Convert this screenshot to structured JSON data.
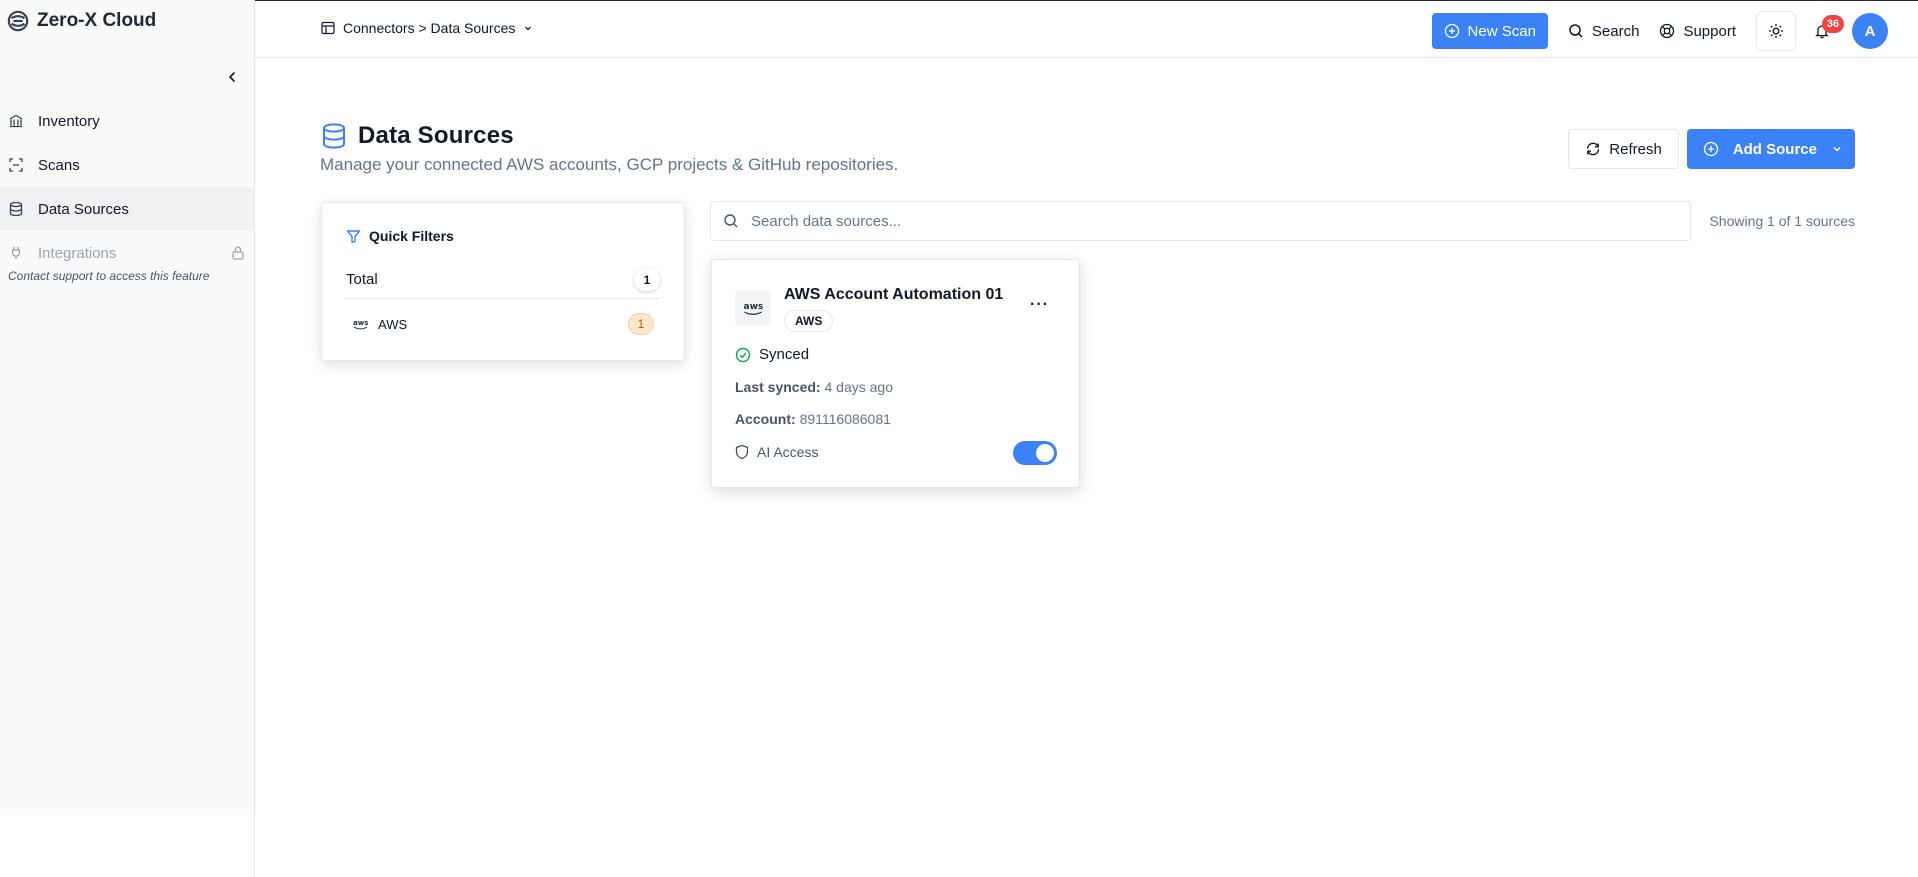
{
  "brand": {
    "name": "Zero-X Cloud"
  },
  "sidebar": {
    "items": [
      {
        "label": "Inventory",
        "icon": "bank-icon"
      },
      {
        "label": "Scans",
        "icon": "scan-icon"
      },
      {
        "label": "Data Sources",
        "icon": "database-icon",
        "active": true
      },
      {
        "label": "Integrations",
        "icon": "plug-icon",
        "disabled": true
      }
    ],
    "note": "Contact support to access this feature"
  },
  "header": {
    "breadcrumb": "Connectors > Data Sources",
    "new_scan_label": "New Scan",
    "search_label": "Search",
    "support_label": "Support",
    "notification_count": "36",
    "avatar_initial": "A"
  },
  "page": {
    "title": "Data Sources",
    "subtitle": "Manage your connected AWS accounts, GCP projects & GitHub repositories.",
    "refresh_label": "Refresh",
    "add_source_label": "Add Source"
  },
  "filters": {
    "title": "Quick Filters",
    "total_label": "Total",
    "total_count": "1",
    "items": [
      {
        "label": "AWS",
        "count": "1"
      }
    ]
  },
  "search": {
    "placeholder": "Search data sources...",
    "showing": "Showing 1 of 1 sources"
  },
  "sources": [
    {
      "name": "AWS Account Automation 01",
      "tag": "AWS",
      "logo_text": "aws",
      "status": "Synced",
      "last_synced_label": "Last synced:",
      "last_synced_value": "4 days ago",
      "account_label": "Account:",
      "account_value": "891116086081",
      "ai_access_label": "AI Access",
      "ai_access_enabled": true
    }
  ],
  "colors": {
    "accent": "#3b82f6",
    "danger": "#ef4444",
    "success": "#16a34a"
  }
}
